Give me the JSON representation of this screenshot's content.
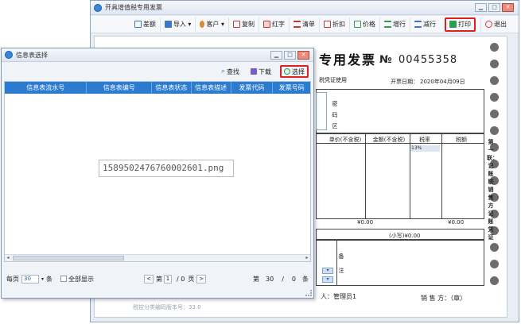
{
  "main_window": {
    "title": "开具增值税专用发票",
    "toolbar": [
      {
        "label": "差额",
        "icon": "difference-icon",
        "color": "#3a78c9"
      },
      {
        "label": "导入 ▾",
        "icon": "import-icon",
        "color": "#3a78c9"
      },
      {
        "label": "客户 ▾",
        "icon": "customer-icon",
        "color": "#d98a2b"
      },
      {
        "label": "复制",
        "icon": "copy-icon",
        "color": "#c0392b"
      },
      {
        "label": "红字",
        "icon": "red-letter-icon",
        "color": "#c0392b"
      },
      {
        "label": "清单",
        "icon": "list-icon",
        "color": "#c0392b"
      },
      {
        "label": "折扣",
        "icon": "discount-icon",
        "color": "#c0392b"
      },
      {
        "label": "价格",
        "icon": "price-icon",
        "color": "#2e9c4e"
      },
      {
        "label": "增行",
        "icon": "add-row-icon",
        "color": "#2e9c4e"
      },
      {
        "label": "减行",
        "icon": "remove-row-icon",
        "color": "#3a78c9"
      },
      {
        "label": "打印",
        "icon": "print-icon",
        "color": "#2e9c4e"
      },
      {
        "label": "退出",
        "icon": "exit-icon",
        "color": "#d33"
      }
    ],
    "invoice": {
      "title_fragment": "专用发票",
      "number_label": "№",
      "number": "00455358",
      "subtitle_fragment": "税凭证使用",
      "date_label": "开票日期：",
      "date": "2020年04月09日",
      "password_area_label": [
        "密",
        "码",
        "区"
      ],
      "columns": [
        "单价(不含税)",
        "金额(不含税)",
        "税率",
        "税额"
      ],
      "tax_rate": "13%",
      "side_label": "第一联：记账联 销售方记账凭证",
      "amount_left": "¥0.00",
      "amount_right": "¥0.00",
      "total_label": "(小写)¥0.00",
      "remarks_label": [
        "备",
        "注"
      ],
      "issuer_label": "人：管理员1",
      "seller_label": "销 售 方：（章）"
    }
  },
  "dialog": {
    "title": "信息表选择",
    "toolbar": [
      {
        "label": "查找",
        "icon": "search-icon"
      },
      {
        "label": "下载",
        "icon": "download-icon"
      },
      {
        "label": "选择",
        "icon": "select-icon"
      }
    ],
    "table": {
      "headers": [
        "信息表流水号",
        "信息表编号",
        "信息表状态",
        "信息表描述",
        "发票代码",
        "发票号码"
      ]
    },
    "image_filename": "1589502476760002601.png",
    "pager": {
      "per_page_label": "每页",
      "per_page_value": "30",
      "per_page_unit": "条",
      "show_all_label": "全部显示",
      "page_prefix": "第",
      "page_value": "1",
      "page_total": "/ 0",
      "page_suffix": "页",
      "range_prefix": "第",
      "range_from": "30",
      "range_sep": "/",
      "range_to": "0",
      "range_suffix": "条"
    }
  },
  "bottom_faint_text": "税控分类编码版本号：33.0"
}
